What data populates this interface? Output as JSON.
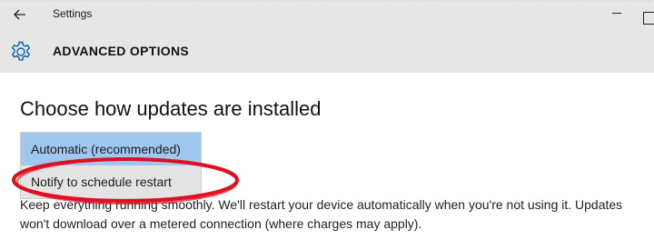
{
  "window": {
    "title": "Settings"
  },
  "header": {
    "section_title": "ADVANCED OPTIONS",
    "back_icon": "back-arrow-icon",
    "settings_icon": "gear-icon"
  },
  "main": {
    "heading": "Choose how updates are installed",
    "dropdown": {
      "options": [
        "Automatic (recommended)",
        "Notify to schedule restart"
      ],
      "selected": "Automatic (recommended)",
      "highlighted": "Notify to schedule restart"
    },
    "description": {
      "line1": "Keep everything running smoothly. We'll restart your device automatically when you're not using it. Updates",
      "line2": "won't download over a metered connection (where charges may apply)."
    }
  },
  "colors": {
    "header_bg": "#e6e6e6",
    "accent": "#0063b1",
    "selected_option_bg": "#9fc8ef",
    "annotation_red": "#e01020"
  }
}
